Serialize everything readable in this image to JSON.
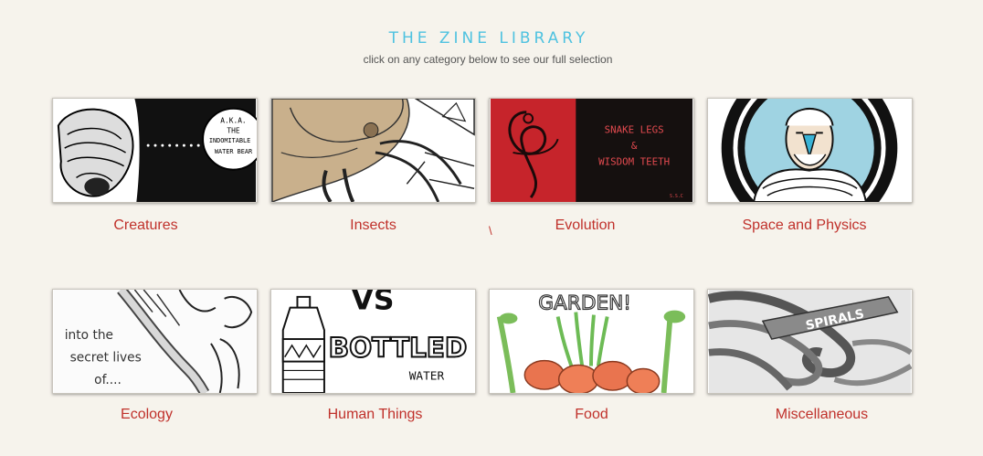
{
  "header": {
    "title": "THE ZINE LIBRARY",
    "subtitle": "click on any category below to see our full selection"
  },
  "categories": [
    {
      "label": "Creatures",
      "image_text": [
        "A.K.A.",
        "THE",
        "INDOMITABLE",
        "WATER BEAR"
      ]
    },
    {
      "label": "Insects"
    },
    {
      "label": "Evolution",
      "image_text": [
        "SNAKE LEGS",
        "&",
        "WISDOM TEETH",
        "S.S.C"
      ]
    },
    {
      "label": "Space and Physics"
    },
    {
      "label": "Ecology",
      "image_text": [
        "into the",
        "secret lives",
        "of...."
      ]
    },
    {
      "label": "Human Things",
      "image_text": [
        "VS",
        "BOTTLED",
        "WATER"
      ]
    },
    {
      "label": "Food",
      "image_text": [
        "GARDEN!"
      ]
    },
    {
      "label": "Miscellaneous",
      "image_text": [
        "SPIRALS"
      ]
    }
  ],
  "stray_mark": "\\",
  "colors": {
    "background": "#f6f3ec",
    "title": "#4fc2e0",
    "label": "#c0312b"
  }
}
